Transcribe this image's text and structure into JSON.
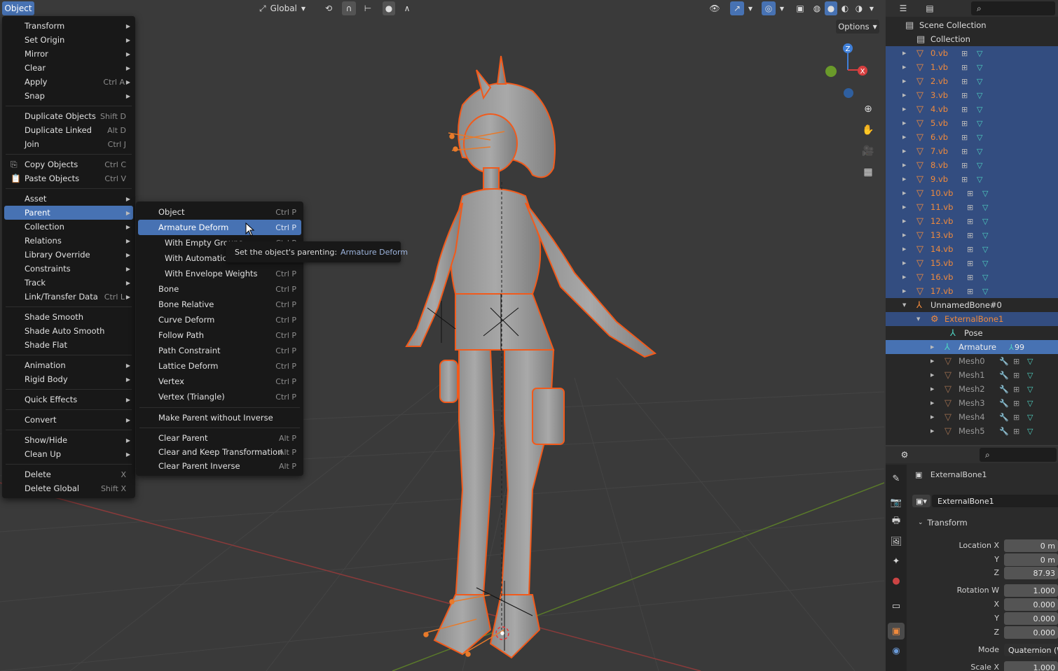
{
  "header": {
    "object_menu": "Object",
    "orientation": "Global",
    "options": "Options"
  },
  "object_menu": {
    "items": [
      {
        "label": "Transform",
        "shortcut": "",
        "sub": true
      },
      {
        "label": "Set Origin",
        "shortcut": "",
        "sub": true
      },
      {
        "label": "Mirror",
        "shortcut": "",
        "sub": true
      },
      {
        "label": "Clear",
        "shortcut": "",
        "sub": true
      },
      {
        "label": "Apply",
        "shortcut": "Ctrl A",
        "sub": true
      },
      {
        "label": "Snap",
        "shortcut": "",
        "sub": true
      },
      {
        "label": "Duplicate Objects",
        "shortcut": "Shift D",
        "sub": false
      },
      {
        "label": "Duplicate Linked",
        "shortcut": "Alt D",
        "sub": false
      },
      {
        "label": "Join",
        "shortcut": "Ctrl J",
        "sub": false
      },
      {
        "label": "Copy Objects",
        "shortcut": "Ctrl C",
        "sub": false
      },
      {
        "label": "Paste Objects",
        "shortcut": "Ctrl V",
        "sub": false
      },
      {
        "label": "Asset",
        "shortcut": "",
        "sub": true
      },
      {
        "label": "Parent",
        "shortcut": "",
        "sub": true
      },
      {
        "label": "Collection",
        "shortcut": "",
        "sub": true
      },
      {
        "label": "Relations",
        "shortcut": "",
        "sub": true
      },
      {
        "label": "Library Override",
        "shortcut": "",
        "sub": true
      },
      {
        "label": "Constraints",
        "shortcut": "",
        "sub": true
      },
      {
        "label": "Track",
        "shortcut": "",
        "sub": true
      },
      {
        "label": "Link/Transfer Data",
        "shortcut": "Ctrl L",
        "sub": true
      },
      {
        "label": "Shade Smooth",
        "shortcut": "",
        "sub": false
      },
      {
        "label": "Shade Auto Smooth",
        "shortcut": "",
        "sub": false
      },
      {
        "label": "Shade Flat",
        "shortcut": "",
        "sub": false
      },
      {
        "label": "Animation",
        "shortcut": "",
        "sub": true
      },
      {
        "label": "Rigid Body",
        "shortcut": "",
        "sub": true
      },
      {
        "label": "Quick Effects",
        "shortcut": "",
        "sub": true
      },
      {
        "label": "Convert",
        "shortcut": "",
        "sub": true
      },
      {
        "label": "Show/Hide",
        "shortcut": "",
        "sub": true
      },
      {
        "label": "Clean Up",
        "shortcut": "",
        "sub": true
      },
      {
        "label": "Delete",
        "shortcut": "X",
        "sub": false
      },
      {
        "label": "Delete Global",
        "shortcut": "Shift X",
        "sub": false
      }
    ]
  },
  "parent_menu": {
    "items": [
      {
        "label": "Object",
        "shortcut": "Ctrl P"
      },
      {
        "label": "Armature Deform",
        "shortcut": "Ctrl P"
      },
      {
        "label": "With Empty Groups",
        "shortcut": "Ctrl P"
      },
      {
        "label": "With Automatic W",
        "shortcut": ""
      },
      {
        "label": "With Envelope Weights",
        "shortcut": "Ctrl P"
      },
      {
        "label": "Bone",
        "shortcut": "Ctrl P"
      },
      {
        "label": "Bone Relative",
        "shortcut": "Ctrl P"
      },
      {
        "label": "Curve Deform",
        "shortcut": "Ctrl P"
      },
      {
        "label": "Follow Path",
        "shortcut": "Ctrl P"
      },
      {
        "label": "Path Constraint",
        "shortcut": "Ctrl P"
      },
      {
        "label": "Lattice Deform",
        "shortcut": "Ctrl P"
      },
      {
        "label": "Vertex",
        "shortcut": "Ctrl P"
      },
      {
        "label": "Vertex (Triangle)",
        "shortcut": "Ctrl P"
      },
      {
        "label": "Make Parent without Inverse",
        "shortcut": ""
      },
      {
        "label": "Clear Parent",
        "shortcut": "Alt P"
      },
      {
        "label": "Clear and Keep Transformation",
        "shortcut": "Alt P"
      },
      {
        "label": "Clear Parent Inverse",
        "shortcut": "Alt P"
      }
    ]
  },
  "tooltip": {
    "text": "Set the object's parenting:",
    "value": "Armature Deform"
  },
  "outliner": {
    "scene_collection": "Scene Collection",
    "collection": "Collection",
    "vb_items": [
      "0.vb",
      "1.vb",
      "2.vb",
      "3.vb",
      "4.vb",
      "5.vb",
      "6.vb",
      "7.vb",
      "8.vb",
      "9.vb",
      "10.vb",
      "11.vb",
      "12.vb",
      "13.vb",
      "14.vb",
      "15.vb",
      "16.vb",
      "17.vb"
    ],
    "armature_obj": "UnnamedBone#0",
    "external_bone": "ExternalBone1",
    "pose": "Pose",
    "armature": "Armature",
    "armature_badge": "99",
    "meshes": [
      "Mesh0",
      "Mesh1",
      "Mesh2",
      "Mesh3",
      "Mesh4",
      "Mesh5"
    ]
  },
  "properties": {
    "object_name": "ExternalBone1",
    "datablock": "ExternalBone1",
    "transform": "Transform",
    "location_x_label": "Location X",
    "location_x": "0 m",
    "location_y_label": "Y",
    "location_y": "0 m",
    "location_z_label": "Z",
    "location_z": "87.93",
    "rotation_w_label": "Rotation W",
    "rotation_w": "1.000",
    "rotation_x_label": "X",
    "rotation_x": "0.000",
    "rotation_y_label": "Y",
    "rotation_y": "0.000",
    "rotation_z_label": "Z",
    "rotation_z": "0.000",
    "mode_label": "Mode",
    "mode": "Quaternion (WXYZ)",
    "scale_x_label": "Scale X",
    "scale_x": "1.000"
  },
  "gizmo": {
    "z": "Z",
    "x": "X"
  },
  "colors": {
    "accent": "#4772b3",
    "selected_row": "#334d80",
    "object_orange": "#f08a3c",
    "outline_orange": "#f25a1b"
  }
}
